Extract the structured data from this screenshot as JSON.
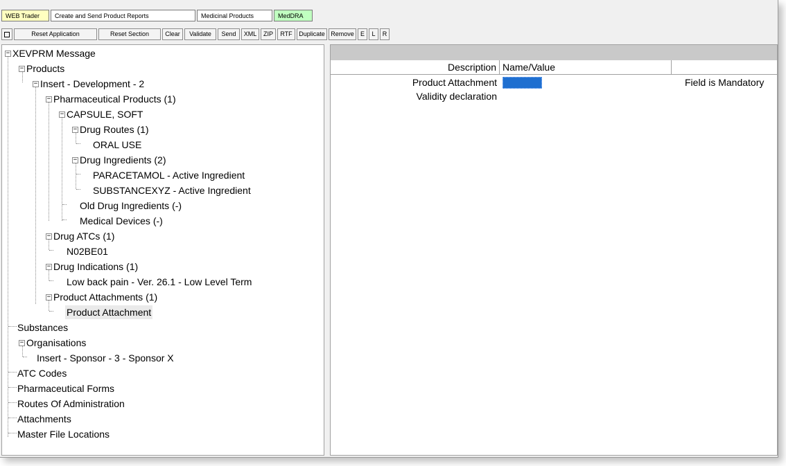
{
  "tabs": [
    {
      "label": "WEB Trader",
      "bg": "#ffffc0"
    },
    {
      "label": "Create and Send Product Reports",
      "bg": "#ffffff"
    },
    {
      "label": "Medicinal Products",
      "bg": "#ffffff"
    },
    {
      "label": "MedDRA",
      "bg": "#c0ffc0"
    }
  ],
  "toolbar": [
    {
      "label": ""
    },
    {
      "label": "Reset Application"
    },
    {
      "label": "Reset Section"
    },
    {
      "label": "Clear"
    },
    {
      "label": "Validate"
    },
    {
      "label": "Send"
    },
    {
      "label": "XML"
    },
    {
      "label": "ZIP"
    },
    {
      "label": "RTF"
    },
    {
      "label": "Duplicate"
    },
    {
      "label": "Remove"
    },
    {
      "label": "E"
    },
    {
      "label": "L"
    },
    {
      "label": "R"
    }
  ],
  "tree": [
    {
      "label": "XEVPRM Message"
    },
    {
      "label": "Products"
    },
    {
      "label": "Insert - Development - 2"
    },
    {
      "label": "Pharmaceutical Products (1)"
    },
    {
      "label": "CAPSULE, SOFT"
    },
    {
      "label": "Drug Routes (1)"
    },
    {
      "label": "ORAL USE"
    },
    {
      "label": "Drug Ingredients (2)"
    },
    {
      "label": "PARACETAMOL - Active Ingredient"
    },
    {
      "label": "SUBSTANCEXYZ - Active Ingredient"
    },
    {
      "label": "Old Drug Ingredients (-)"
    },
    {
      "label": "Medical Devices (-)"
    },
    {
      "label": "Drug ATCs (1)"
    },
    {
      "label": "N02BE01"
    },
    {
      "label": "Drug Indications (1)"
    },
    {
      "label": "Low back pain - Ver. 26.1 - Low Level Term"
    },
    {
      "label": "Product Attachments (1)"
    },
    {
      "label": "Product Attachment"
    },
    {
      "label": "Substances"
    },
    {
      "label": "Organisations"
    },
    {
      "label": "Insert - Sponsor - 3 - Sponsor X"
    },
    {
      "label": "ATC Codes"
    },
    {
      "label": "Pharmaceutical Forms"
    },
    {
      "label": "Routes Of Administration"
    },
    {
      "label": "Attachments"
    },
    {
      "label": "Master File Locations"
    }
  ],
  "grid": {
    "columns": [
      "Description",
      "Name/Value",
      ""
    ],
    "rows": [
      {
        "description": "Product Attachment",
        "value": "",
        "note": "Field is Mandatory"
      },
      {
        "description": "Validity declaration",
        "value": "",
        "note": ""
      }
    ],
    "value_color": "#1f6fd0"
  }
}
